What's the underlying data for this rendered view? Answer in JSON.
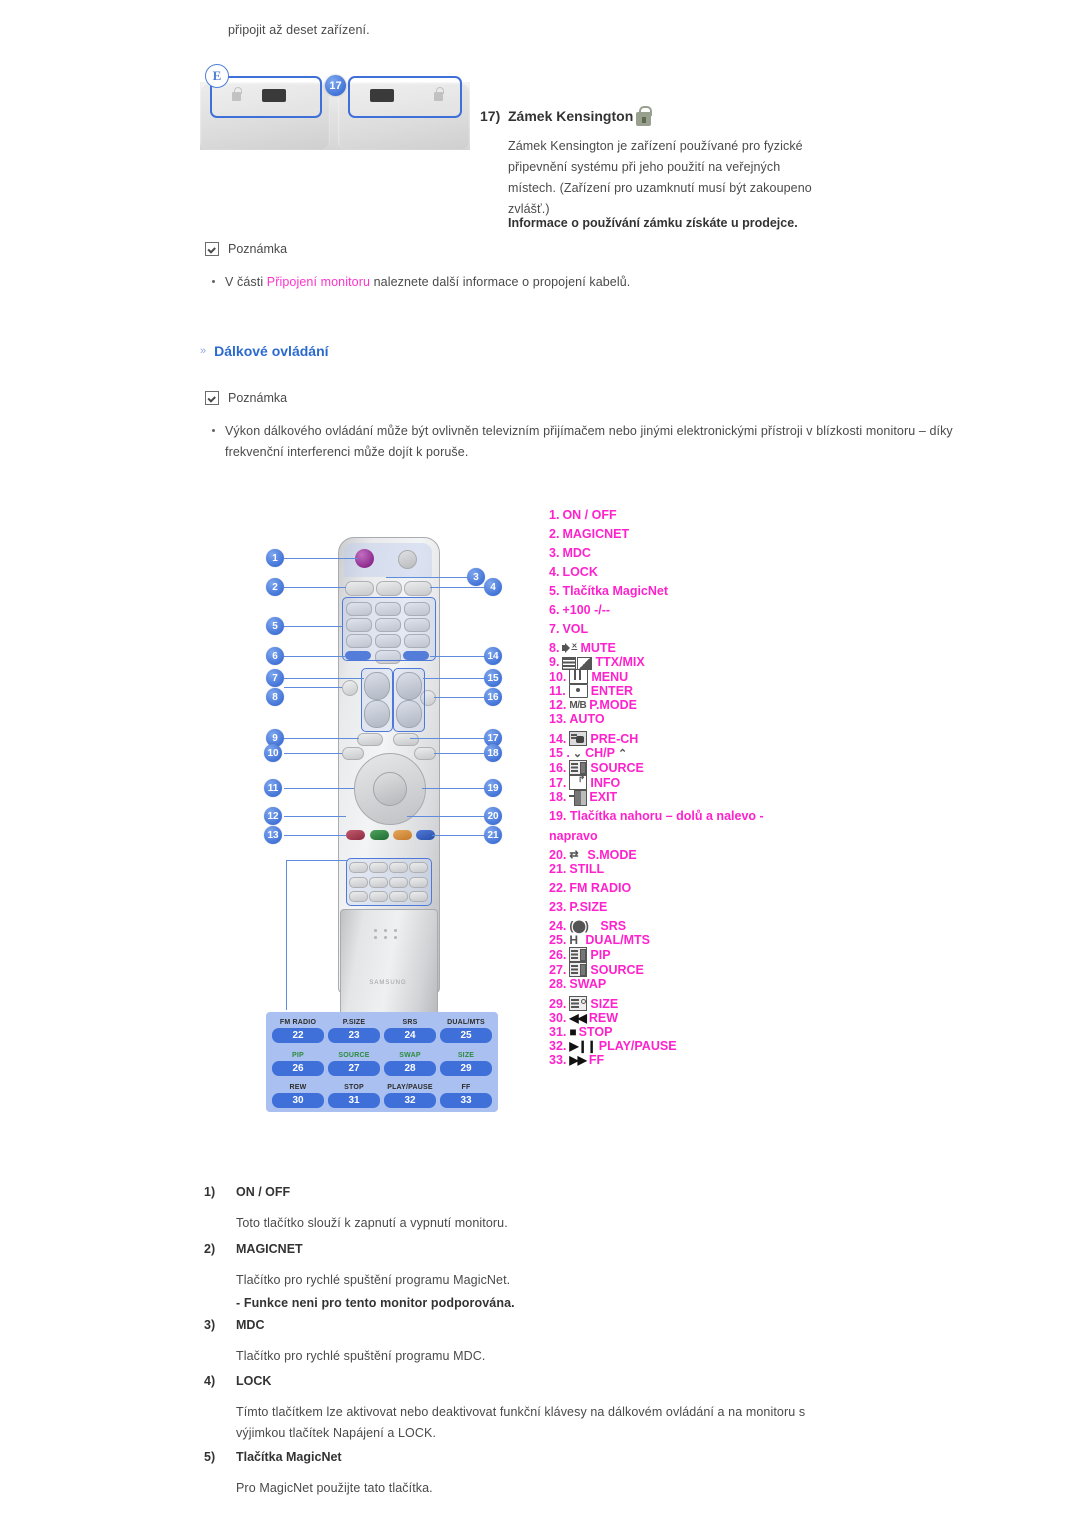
{
  "top_paragraph": "připojit až deset zařízení.",
  "kensington": {
    "figure_badge": "E",
    "callout": "17",
    "heading_num": "17)",
    "heading_text": "Zámek Kensington",
    "lock_icon": "kensington-lock-icon",
    "body": "Zámek Kensington je zařízení používané pro fyzické připevnění systému při jeho použití na veřejných místech. (Zařízení pro uzamknutí musí být zakoupeno zvlášť.)",
    "bold_note": "Informace o používání zámku získáte u prodejce."
  },
  "note1": {
    "label": "Poznámka",
    "bullet_prefix": "V části ",
    "bullet_link": "Připojení monitoru",
    "bullet_suffix": " naleznete další informace o propojení kabelů."
  },
  "section": {
    "arrow": "»",
    "title": "Dálkové ovládání"
  },
  "note2": {
    "label": "Poznámka",
    "bullet": "Výkon dálkového ovládání může být ovlivněn televizním přijímačem nebo jinými elektronickými přístroji v blízkosti monitoru – díky frekvenční interferenci může dojít k poruše."
  },
  "remote_callouts": {
    "left": [
      "1",
      "2",
      "5",
      "6",
      "7",
      "8",
      "9",
      "10",
      "11",
      "12",
      "13"
    ],
    "right": [
      "3",
      "4",
      "14",
      "15",
      "16",
      "17",
      "18",
      "19",
      "20",
      "21"
    ]
  },
  "legend_panel": {
    "cells": [
      {
        "name": "FM RADIO",
        "num": "22",
        "green": false
      },
      {
        "name": "P.SIZE",
        "num": "23",
        "green": false
      },
      {
        "name": "SRS",
        "num": "24",
        "green": false
      },
      {
        "name": "DUAL/MTS",
        "num": "25",
        "green": false
      },
      {
        "name": "PIP",
        "num": "26",
        "green": true
      },
      {
        "name": "SOURCE",
        "num": "27",
        "green": true
      },
      {
        "name": "SWAP",
        "num": "28",
        "green": true
      },
      {
        "name": "SIZE",
        "num": "29",
        "green": true
      },
      {
        "name": "REW",
        "num": "30",
        "green": false
      },
      {
        "name": "STOP",
        "num": "31",
        "green": false
      },
      {
        "name": "PLAY/PAUSE",
        "num": "32",
        "green": false
      },
      {
        "name": "FF",
        "num": "33",
        "green": false
      }
    ]
  },
  "button_list": {
    "color": "#ff22cc",
    "items": [
      {
        "num": "1.",
        "label": "ON / OFF",
        "icon": null
      },
      {
        "num": "2.",
        "label": "MAGICNET",
        "icon": null
      },
      {
        "num": "3.",
        "label": "MDC",
        "icon": null
      },
      {
        "num": "4.",
        "label": "LOCK",
        "icon": null
      },
      {
        "num": "5.",
        "label": "Tlačítka MagicNet",
        "icon": null
      },
      {
        "num": "6.",
        "label": "+100 -/--",
        "icon": null
      },
      {
        "num": "7.",
        "label": "VOL",
        "icon": null
      },
      {
        "num": "8.",
        "label": "MUTE",
        "icon": "mute-icon"
      },
      {
        "num": "9.",
        "label": "TTX/MIX",
        "icon": "teletext-mix-icon"
      },
      {
        "num": "10.",
        "label": "MENU",
        "icon": "menu-icon"
      },
      {
        "num": "11.",
        "label": "ENTER",
        "icon": "enter-icon"
      },
      {
        "num": "12.",
        "label": "P.MODE",
        "icon": "mb-icon"
      },
      {
        "num": "13.",
        "label": "AUTO",
        "icon": null
      },
      {
        "num": "14.",
        "label": "PRE-CH",
        "icon": "pre-channel-icon"
      },
      {
        "num": "15 .",
        "label": "CH/P",
        "icon": "channel-updown-icon"
      },
      {
        "num": "16.",
        "label": "SOURCE",
        "icon": "source-icon"
      },
      {
        "num": "17.",
        "label": "INFO",
        "icon": "info-icon"
      },
      {
        "num": "18.",
        "label": "EXIT",
        "icon": "exit-icon"
      },
      {
        "num": "19.",
        "label": "Tlačítka nahoru – dolů a nalevo - napravo",
        "icon": null
      },
      {
        "num": "20.",
        "label": "S.MODE",
        "icon": "sound-mode-icon"
      },
      {
        "num": "21.",
        "label": "STILL",
        "icon": null
      },
      {
        "num": "22.",
        "label": "FM RADIO",
        "icon": null
      },
      {
        "num": "23.",
        "label": "P.SIZE",
        "icon": null
      },
      {
        "num": "24.",
        "label": "SRS",
        "icon": "srs-icon"
      },
      {
        "num": "25.",
        "label": "DUAL/MTS",
        "icon": "dual-mts-icon"
      },
      {
        "num": "26.",
        "label": "PIP",
        "icon": "pip-icon"
      },
      {
        "num": "27.",
        "label": "SOURCE",
        "icon": "source-icon"
      },
      {
        "num": "28.",
        "label": "SWAP",
        "icon": null
      },
      {
        "num": "29.",
        "label": "SIZE",
        "icon": "size-icon"
      },
      {
        "num": "30.",
        "label": "REW",
        "icon": "rewind-icon"
      },
      {
        "num": "31.",
        "label": "STOP",
        "icon": "stop-icon"
      },
      {
        "num": "32.",
        "label": "PLAY/PAUSE",
        "icon": "play-pause-icon"
      },
      {
        "num": "33.",
        "label": "FF",
        "icon": "fast-forward-icon"
      }
    ]
  },
  "descriptions": [
    {
      "idx": "1)",
      "title": "ON / OFF",
      "body": "Toto tlačítko slouží k zapnutí a vypnutí monitoru.",
      "bold": null
    },
    {
      "idx": "2)",
      "title": "MAGICNET",
      "body": "Tlačítko pro rychlé spuštění programu MagicNet.",
      "bold": "- Funkce neni pro tento monitor podporována."
    },
    {
      "idx": "3)",
      "title": "MDC",
      "body": "Tlačítko pro rychlé spuštění programu MDC.",
      "bold": null
    },
    {
      "idx": "4)",
      "title": "LOCK",
      "body": "Tímto tlačítkem lze aktivovat nebo deaktivovat funkční klávesy na dálkovém ovládání a na monitoru s výjimkou tlačítek Napájení a LOCK.",
      "bold": null
    },
    {
      "idx": "5)",
      "title": "Tlačítka MagicNet",
      "body": "Pro MagicNet použijte tato tlačítka.",
      "bold": null
    }
  ]
}
